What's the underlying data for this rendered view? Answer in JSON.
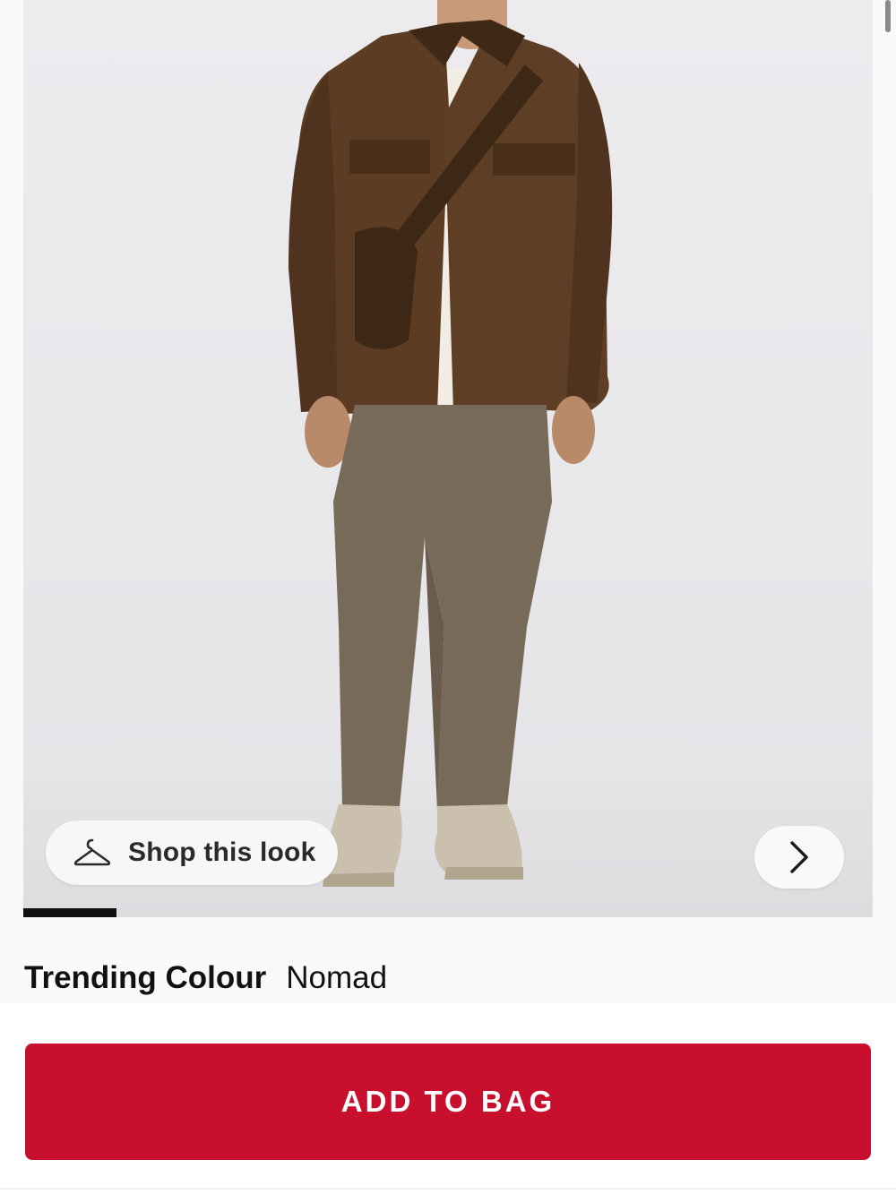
{
  "product_image": {
    "alt": "Model wearing brown overshirt, white tee and nomad pants",
    "shop_look_label": "Shop this look",
    "shop_look_icon": "hanger-icon",
    "next_icon": "chevron-right-icon",
    "progress_fraction": 0.11
  },
  "colour": {
    "title": "Trending Colour",
    "value": "Nomad"
  },
  "cta": {
    "add_to_bag_label": "ADD TO BAG",
    "color": "#c8102e"
  }
}
